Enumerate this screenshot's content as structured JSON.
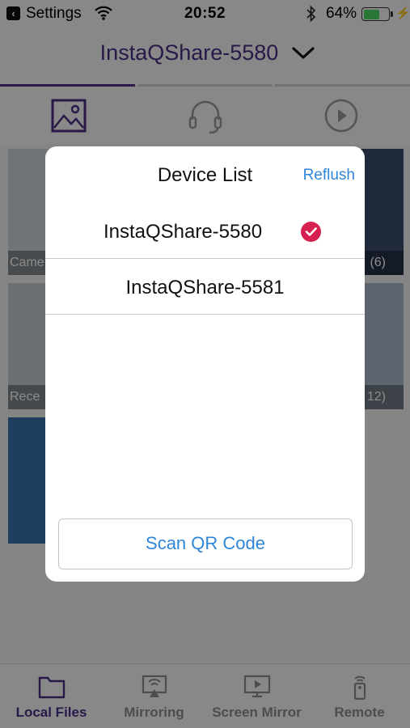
{
  "status_bar": {
    "back_app": "Settings",
    "time": "20:52",
    "battery_percent": "64%",
    "battery_level": 0.64
  },
  "nav": {
    "title": "InstaQShare-5580"
  },
  "media_tabs": [
    {
      "icon": "photo-icon",
      "active": true
    },
    {
      "icon": "headphones-icon",
      "active": false
    },
    {
      "icon": "play-circle-icon",
      "active": false
    }
  ],
  "albums": [
    {
      "label": "Came",
      "count": "(6)"
    },
    {
      "label": "Rece",
      "count": "12)"
    }
  ],
  "dialog": {
    "title": "Device List",
    "refresh_label": "Reflush",
    "devices": [
      {
        "name": "InstaQShare-5580",
        "selected": true
      },
      {
        "name": "InstaQShare-5581",
        "selected": false
      }
    ],
    "scan_button": "Scan QR Code"
  },
  "bottom_bar": [
    {
      "label": "Local Files",
      "icon": "folder-icon",
      "active": true
    },
    {
      "label": "Mirroring",
      "icon": "mirroring-icon",
      "active": false
    },
    {
      "label": "Screen Mirror",
      "icon": "screen-mirror-icon",
      "active": false
    },
    {
      "label": "Remote",
      "icon": "remote-icon",
      "active": false
    }
  ],
  "colors": {
    "accent": "#4b2f86",
    "link": "#2f86d8",
    "check": "#d6204f"
  }
}
